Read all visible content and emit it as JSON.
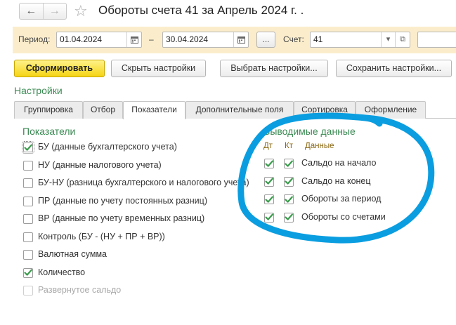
{
  "title_bar": {
    "back_glyph": "←",
    "forward_glyph": "→",
    "star_glyph": "☆",
    "title": "Обороты счета 41 за Апрель 2024 г. ."
  },
  "period_bar": {
    "period_label": "Период:",
    "date_from": "01.04.2024",
    "dash": "–",
    "date_to": "30.04.2024",
    "ellipsis": "...",
    "account_label": "Счет:",
    "account_value": "41",
    "calendar_icon": "calendar-icon",
    "dropdown_glyph": "▾",
    "open_glyph": "⧉"
  },
  "toolbar": {
    "generate": "Сформировать",
    "hide_settings": "Скрыть настройки",
    "choose_settings": "Выбрать настройки...",
    "save_settings": "Сохранить настройки..."
  },
  "settings_title": "Настройки",
  "tabs": [
    {
      "label": "Группировка",
      "active": false
    },
    {
      "label": "Отбор",
      "active": false
    },
    {
      "label": "Показатели",
      "active": true
    },
    {
      "label": "Дополнительные поля",
      "active": false
    },
    {
      "label": "Сортировка",
      "active": false
    },
    {
      "label": "Оформление",
      "active": false
    }
  ],
  "indicators": {
    "title": "Показатели",
    "items": [
      {
        "label": "БУ (данные бухгалтерского учета)",
        "checked": true,
        "disabled": false
      },
      {
        "label": "НУ (данные налогового учета)",
        "checked": false,
        "disabled": false
      },
      {
        "label": "БУ-НУ (разница бухгалтерского и налогового учета)",
        "checked": false,
        "disabled": false
      },
      {
        "label": "ПР (данные по учету постоянных разниц)",
        "checked": false,
        "disabled": false
      },
      {
        "label": "ВР (данные по учету временных разниц)",
        "checked": false,
        "disabled": false
      },
      {
        "label": "Контроль (БУ - (НУ + ПР + ВР))",
        "checked": false,
        "disabled": false
      },
      {
        "label": "Валютная сумма",
        "checked": false,
        "disabled": false
      },
      {
        "label": "Количество",
        "checked": true,
        "disabled": false
      },
      {
        "label": "Развернутое сальдо",
        "checked": false,
        "disabled": true
      }
    ]
  },
  "output_data": {
    "title": "Выводимые данные",
    "col_dt": "Дт",
    "col_kt": "Кт",
    "col_data": "Данные",
    "rows": [
      {
        "label": "Сальдо на начало",
        "dt": true,
        "kt": true
      },
      {
        "label": "Сальдо на конец",
        "dt": true,
        "kt": true
      },
      {
        "label": "Обороты за период",
        "dt": true,
        "kt": true
      },
      {
        "label": "Обороты со счетами",
        "dt": true,
        "kt": true
      }
    ]
  },
  "colors": {
    "accent_green": "#3b8a53",
    "check_green": "#3a9b4c",
    "period_bar_bg": "#fbedcc",
    "primary_button": "#f5d414",
    "annotation_blue": "#0a9ee0"
  }
}
